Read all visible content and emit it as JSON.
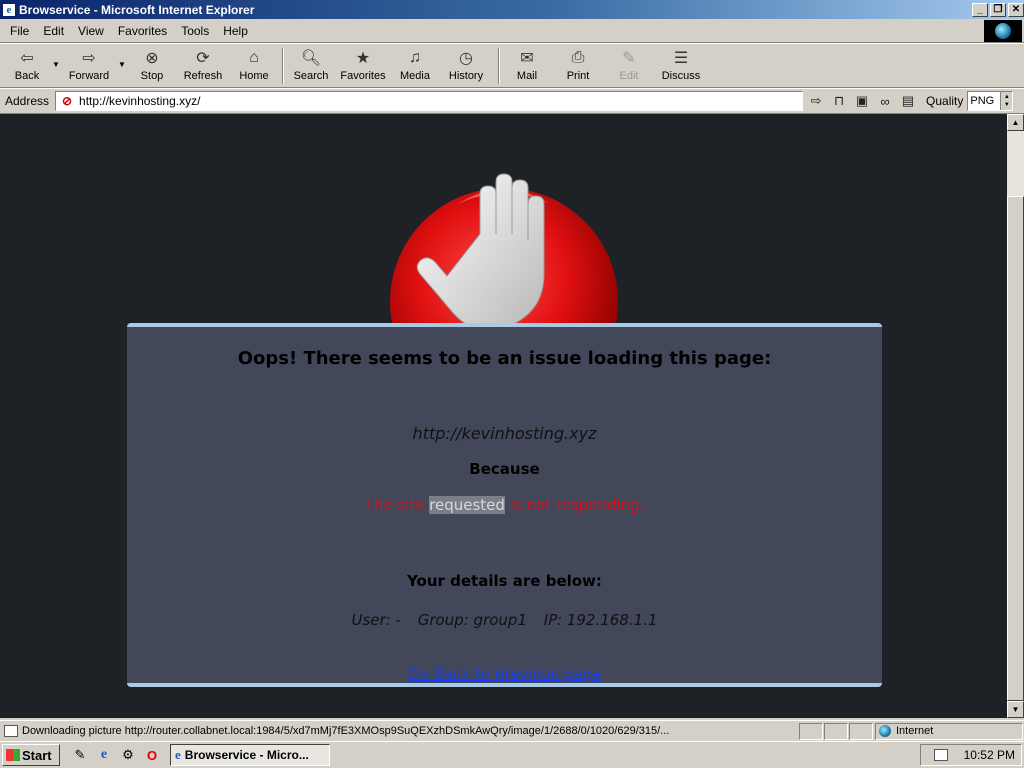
{
  "window": {
    "title": "Browservice - Microsoft Internet Explorer",
    "minimize": "_",
    "restore": "❐",
    "close": "✕"
  },
  "menu": [
    "File",
    "Edit",
    "View",
    "Favorites",
    "Tools",
    "Help"
  ],
  "toolbar": {
    "back": "Back",
    "forward": "Forward",
    "stop": "Stop",
    "refresh": "Refresh",
    "home": "Home",
    "search": "Search",
    "favorites": "Favorites",
    "media": "Media",
    "history": "History",
    "mail": "Mail",
    "print": "Print",
    "edit": "Edit",
    "discuss": "Discuss"
  },
  "address": {
    "label": "Address",
    "url": "http://kevinhosting.xyz/",
    "quality_label": "Quality",
    "quality_value": "PNG"
  },
  "page": {
    "heading": "Oops! There seems to be an issue loading this page:",
    "url": "http://kevinhosting.xyz",
    "because": "Because",
    "reason_pre": "The site ",
    "reason_highlight": "requested",
    "reason_post": " is not responding.",
    "details_title": "Your details are below:",
    "user": "User: -",
    "group": "Group: group1",
    "ip": "IP: 192.168.1.1",
    "go_back": "Go Back to previous page"
  },
  "status": {
    "text": "Downloading picture http://router.collabnet.local:1984/5/xd7mMj7fE3XMOsp9SuQEXzhDSmkAwQry/image/1/2688/0/1020/629/315/...",
    "zone": "Internet"
  },
  "taskbar": {
    "start": "Start",
    "task": "Browservice - Micro...",
    "time": "10:52 PM"
  },
  "icons": {
    "stop_sign": "red-stop-hand-icon"
  }
}
